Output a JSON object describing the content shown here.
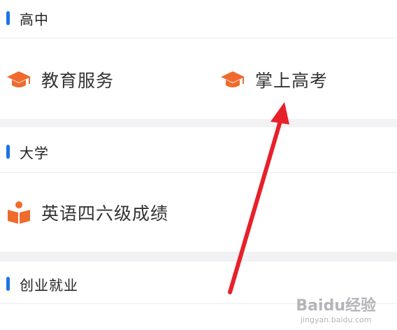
{
  "colors": {
    "accent_bar": "#1a73e8",
    "icon_orange": "#ef6a2e",
    "arrow_red": "#e8202a",
    "background": "#f2f2f4",
    "card": "#ffffff"
  },
  "sections": [
    {
      "title": "高中",
      "items": [
        {
          "label": "教育服务",
          "icon": "graduation-cap-icon"
        },
        {
          "label": "掌上高考",
          "icon": "graduation-cap-icon"
        }
      ]
    },
    {
      "title": "大学",
      "items": [
        {
          "label": "英语四六级成绩",
          "icon": "book-reader-icon"
        }
      ]
    },
    {
      "title": "创业就业",
      "items": []
    }
  ],
  "watermark": {
    "logo": "Baidu经验",
    "sub": "jingyan.baidu.com"
  }
}
